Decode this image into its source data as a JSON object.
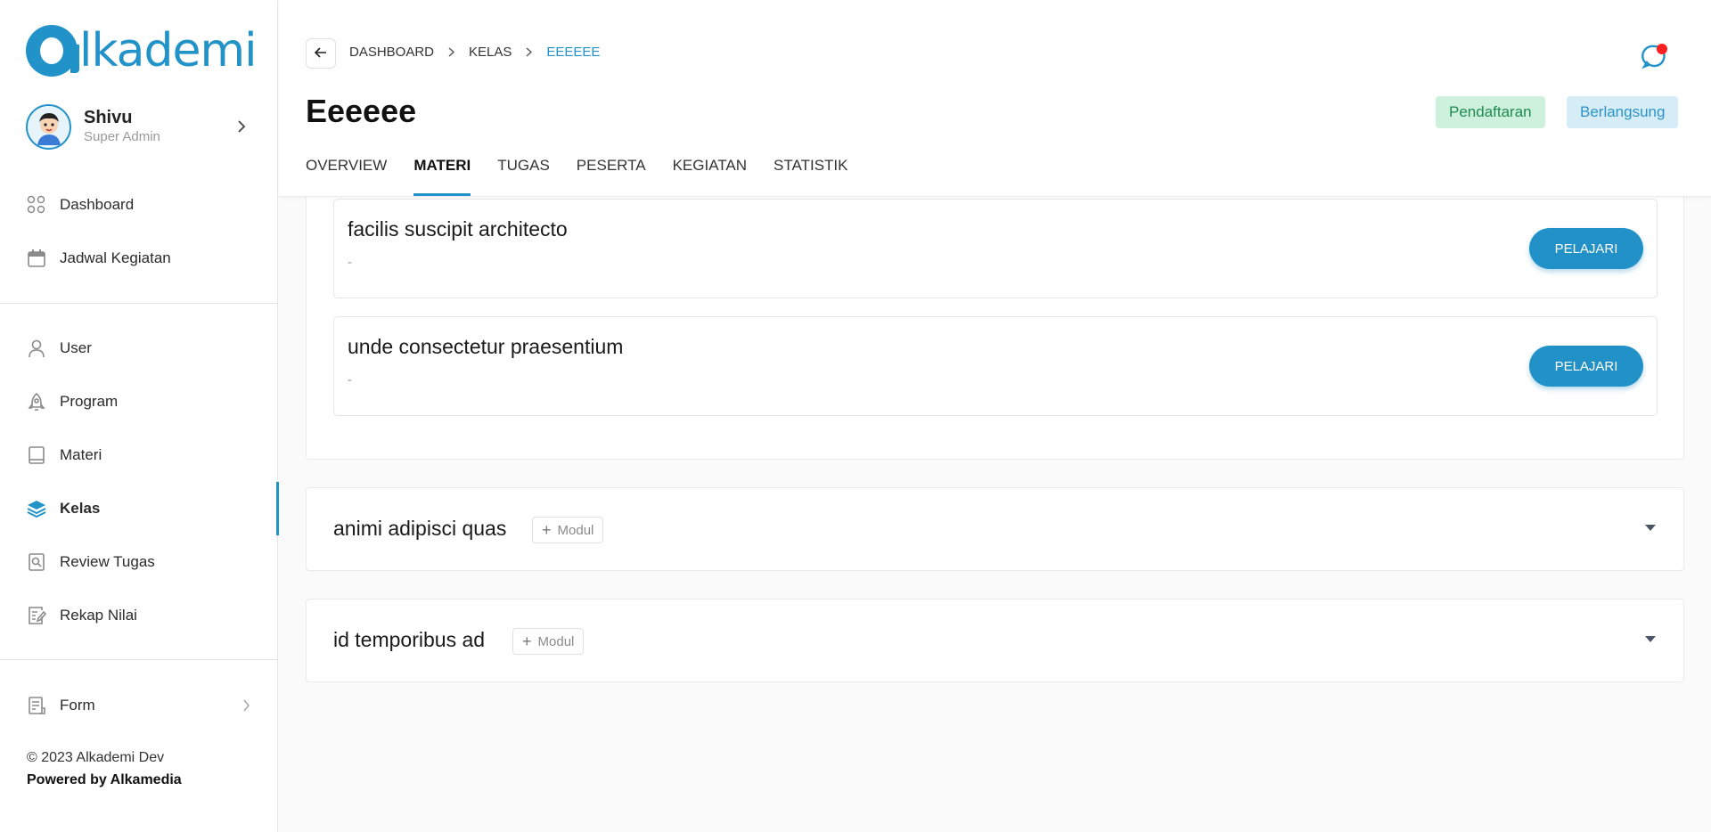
{
  "brand": {
    "logo_text": "lkademi",
    "accent": "#2293c9"
  },
  "profile": {
    "name": "Shivu",
    "role": "Super Admin"
  },
  "sidebar": {
    "group1": [
      {
        "label": "Dashboard",
        "icon": "grid-icon"
      },
      {
        "label": "Jadwal Kegiatan",
        "icon": "calendar-icon"
      }
    ],
    "group2": [
      {
        "label": "User",
        "icon": "user-icon"
      },
      {
        "label": "Program",
        "icon": "rocket-icon"
      },
      {
        "label": "Materi",
        "icon": "book-icon"
      },
      {
        "label": "Kelas",
        "icon": "layers-icon",
        "active": true
      },
      {
        "label": "Review Tugas",
        "icon": "search-doc-icon"
      },
      {
        "label": "Rekap Nilai",
        "icon": "edit-doc-icon"
      }
    ],
    "group3": [
      {
        "label": "Form",
        "icon": "form-icon"
      }
    ],
    "footer": {
      "copyright": "© 2023 Alkademi Dev",
      "powered": "Powered by Alkamedia"
    }
  },
  "breadcrumb": [
    "DASHBOARD",
    "KELAS",
    "EEEEEE"
  ],
  "page": {
    "title": "Eeeeee",
    "badges": {
      "registration": "Pendaftaran",
      "ongoing": "Berlangsung"
    },
    "tabs": [
      "OVERVIEW",
      "MATERI",
      "TUGAS",
      "PESERTA",
      "KEGIATAN",
      "STATISTIK"
    ],
    "active_tab": "MATERI"
  },
  "materi": {
    "modules": [
      {
        "title": "facilis suscipit architecto",
        "subtitle": "-",
        "action": "PELAJARI"
      },
      {
        "title": "unde consectetur praesentium",
        "subtitle": "-",
        "action": "PELAJARI"
      }
    ],
    "sections": [
      {
        "title": "animi adipisci quas",
        "add_label": "Modul"
      },
      {
        "title": "id temporibus ad",
        "add_label": "Modul"
      }
    ]
  },
  "colors": {
    "notification_dot": "#ff1f1f",
    "badge_green_bg": "#cdf1dd",
    "badge_blue_bg": "#d6ecf7"
  }
}
